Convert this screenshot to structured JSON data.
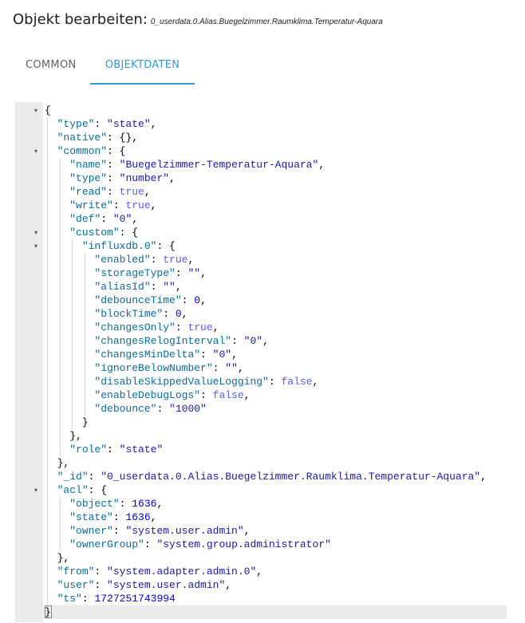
{
  "header": {
    "title": "Objekt bearbeiten:",
    "object_id": "0_userdata.0.Alias.Buegelzimmer.Raumklima.Temperatur-Aquara"
  },
  "tabs": [
    {
      "label": "COMMON",
      "active": false
    },
    {
      "label": "OBJEKTDATEN",
      "active": true
    }
  ],
  "colors": {
    "accent": "#3399cc",
    "gutter": "#ebebeb",
    "json_key": "#0a6c9a",
    "json_string": "#1a1aa6",
    "json_boolean": "#585cf6",
    "json_number": "#0000cd"
  },
  "editor": {
    "lines": [
      [
        [
          "p",
          "{"
        ]
      ],
      [
        [
          "p",
          "  "
        ],
        [
          "k",
          "\"type\""
        ],
        [
          "p",
          ": "
        ],
        [
          "s",
          "\"state\""
        ],
        [
          "p",
          ","
        ]
      ],
      [
        [
          "p",
          "  "
        ],
        [
          "k",
          "\"native\""
        ],
        [
          "p",
          ": {},"
        ]
      ],
      [
        [
          "p",
          "  "
        ],
        [
          "k",
          "\"common\""
        ],
        [
          "p",
          ": {"
        ]
      ],
      [
        [
          "p",
          "    "
        ],
        [
          "k",
          "\"name\""
        ],
        [
          "p",
          ": "
        ],
        [
          "s",
          "\"Buegelzimmer-Temperatur-Aquara\""
        ],
        [
          "p",
          ","
        ]
      ],
      [
        [
          "p",
          "    "
        ],
        [
          "k",
          "\"type\""
        ],
        [
          "p",
          ": "
        ],
        [
          "s",
          "\"number\""
        ],
        [
          "p",
          ","
        ]
      ],
      [
        [
          "p",
          "    "
        ],
        [
          "k",
          "\"read\""
        ],
        [
          "p",
          ": "
        ],
        [
          "b",
          "true"
        ],
        [
          "p",
          ","
        ]
      ],
      [
        [
          "p",
          "    "
        ],
        [
          "k",
          "\"write\""
        ],
        [
          "p",
          ": "
        ],
        [
          "b",
          "true"
        ],
        [
          "p",
          ","
        ]
      ],
      [
        [
          "p",
          "    "
        ],
        [
          "k",
          "\"def\""
        ],
        [
          "p",
          ": "
        ],
        [
          "s",
          "\"0\""
        ],
        [
          "p",
          ","
        ]
      ],
      [
        [
          "p",
          "    "
        ],
        [
          "k",
          "\"custom\""
        ],
        [
          "p",
          ": {"
        ]
      ],
      [
        [
          "p",
          "      "
        ],
        [
          "k",
          "\"influxdb.0\""
        ],
        [
          "p",
          ": {"
        ]
      ],
      [
        [
          "p",
          "        "
        ],
        [
          "k",
          "\"enabled\""
        ],
        [
          "p",
          ": "
        ],
        [
          "b",
          "true"
        ],
        [
          "p",
          ","
        ]
      ],
      [
        [
          "p",
          "        "
        ],
        [
          "k",
          "\"storageType\""
        ],
        [
          "p",
          ": "
        ],
        [
          "s",
          "\"\""
        ],
        [
          "p",
          ","
        ]
      ],
      [
        [
          "p",
          "        "
        ],
        [
          "k",
          "\"aliasId\""
        ],
        [
          "p",
          ": "
        ],
        [
          "s",
          "\"\""
        ],
        [
          "p",
          ","
        ]
      ],
      [
        [
          "p",
          "        "
        ],
        [
          "k",
          "\"debounceTime\""
        ],
        [
          "p",
          ": "
        ],
        [
          "n",
          "0"
        ],
        [
          "p",
          ","
        ]
      ],
      [
        [
          "p",
          "        "
        ],
        [
          "k",
          "\"blockTime\""
        ],
        [
          "p",
          ": "
        ],
        [
          "n",
          "0"
        ],
        [
          "p",
          ","
        ]
      ],
      [
        [
          "p",
          "        "
        ],
        [
          "k",
          "\"changesOnly\""
        ],
        [
          "p",
          ": "
        ],
        [
          "b",
          "true"
        ],
        [
          "p",
          ","
        ]
      ],
      [
        [
          "p",
          "        "
        ],
        [
          "k",
          "\"changesRelogInterval\""
        ],
        [
          "p",
          ": "
        ],
        [
          "s",
          "\"0\""
        ],
        [
          "p",
          ","
        ]
      ],
      [
        [
          "p",
          "        "
        ],
        [
          "k",
          "\"changesMinDelta\""
        ],
        [
          "p",
          ": "
        ],
        [
          "s",
          "\"0\""
        ],
        [
          "p",
          ","
        ]
      ],
      [
        [
          "p",
          "        "
        ],
        [
          "k",
          "\"ignoreBelowNumber\""
        ],
        [
          "p",
          ": "
        ],
        [
          "s",
          "\"\""
        ],
        [
          "p",
          ","
        ]
      ],
      [
        [
          "p",
          "        "
        ],
        [
          "k",
          "\"disableSkippedValueLogging\""
        ],
        [
          "p",
          ": "
        ],
        [
          "b",
          "false"
        ],
        [
          "p",
          ","
        ]
      ],
      [
        [
          "p",
          "        "
        ],
        [
          "k",
          "\"enableDebugLogs\""
        ],
        [
          "p",
          ": "
        ],
        [
          "b",
          "false"
        ],
        [
          "p",
          ","
        ]
      ],
      [
        [
          "p",
          "        "
        ],
        [
          "k",
          "\"debounce\""
        ],
        [
          "p",
          ": "
        ],
        [
          "s",
          "\"1000\""
        ]
      ],
      [
        [
          "p",
          "      }"
        ]
      ],
      [
        [
          "p",
          "    },"
        ]
      ],
      [
        [
          "p",
          "    "
        ],
        [
          "k",
          "\"role\""
        ],
        [
          "p",
          ": "
        ],
        [
          "s",
          "\"state\""
        ]
      ],
      [
        [
          "p",
          "  },"
        ]
      ],
      [
        [
          "p",
          "  "
        ],
        [
          "k",
          "\"_id\""
        ],
        [
          "p",
          ": "
        ],
        [
          "s",
          "\"0_userdata.0.Alias.Buegelzimmer.Raumklima.Temperatur-Aquara\""
        ],
        [
          "p",
          ","
        ]
      ],
      [
        [
          "p",
          "  "
        ],
        [
          "k",
          "\"acl\""
        ],
        [
          "p",
          ": {"
        ]
      ],
      [
        [
          "p",
          "    "
        ],
        [
          "k",
          "\"object\""
        ],
        [
          "p",
          ": "
        ],
        [
          "n",
          "1636"
        ],
        [
          "p",
          ","
        ]
      ],
      [
        [
          "p",
          "    "
        ],
        [
          "k",
          "\"state\""
        ],
        [
          "p",
          ": "
        ],
        [
          "n",
          "1636"
        ],
        [
          "p",
          ","
        ]
      ],
      [
        [
          "p",
          "    "
        ],
        [
          "k",
          "\"owner\""
        ],
        [
          "p",
          ": "
        ],
        [
          "s",
          "\"system.user.admin\""
        ],
        [
          "p",
          ","
        ]
      ],
      [
        [
          "p",
          "    "
        ],
        [
          "k",
          "\"ownerGroup\""
        ],
        [
          "p",
          ": "
        ],
        [
          "s",
          "\"system.group.administrator\""
        ]
      ],
      [
        [
          "p",
          "  },"
        ]
      ],
      [
        [
          "p",
          "  "
        ],
        [
          "k",
          "\"from\""
        ],
        [
          "p",
          ": "
        ],
        [
          "s",
          "\"system.adapter.admin.0\""
        ],
        [
          "p",
          ","
        ]
      ],
      [
        [
          "p",
          "  "
        ],
        [
          "k",
          "\"user\""
        ],
        [
          "p",
          ": "
        ],
        [
          "s",
          "\"system.user.admin\""
        ],
        [
          "p",
          ","
        ]
      ],
      [
        [
          "p",
          "  "
        ],
        [
          "k",
          "\"ts\""
        ],
        [
          "p",
          ": "
        ],
        [
          "n",
          "1727251743994"
        ]
      ],
      [
        [
          "p",
          "}"
        ]
      ]
    ],
    "fold_markers": [
      0,
      3,
      9,
      10,
      28
    ]
  }
}
